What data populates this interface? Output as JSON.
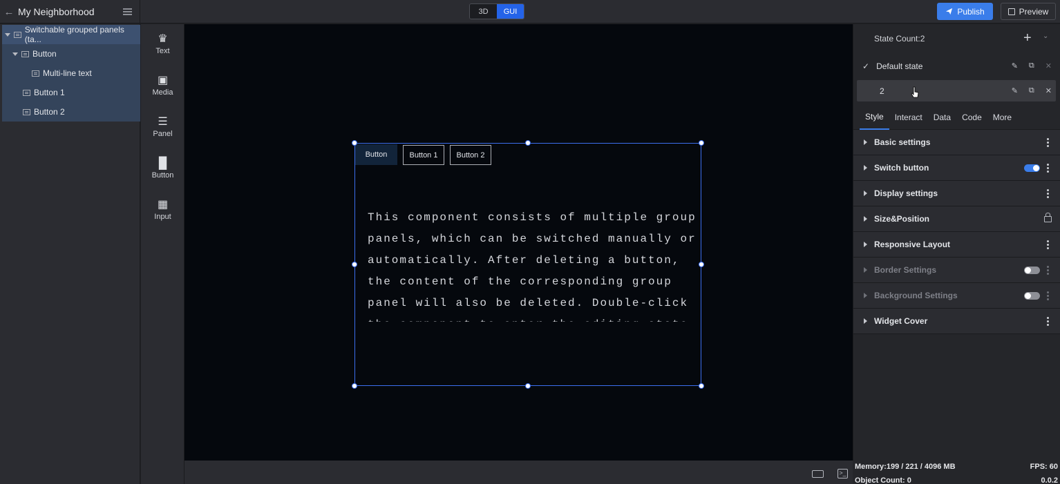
{
  "header": {
    "project_title": "My Neighborhood",
    "mode_3d": "3D",
    "mode_gui": "GUI",
    "publish_label": "Publish",
    "preview_label": "Preview"
  },
  "tree": {
    "items": [
      {
        "label": "Switchable grouped panels (ta..."
      },
      {
        "label": "Button"
      },
      {
        "label": "Multi-line text"
      },
      {
        "label": "Button 1"
      },
      {
        "label": "Button 2"
      }
    ]
  },
  "rail": {
    "items": [
      {
        "label": "Text",
        "icon": "text-icon"
      },
      {
        "label": "Media",
        "icon": "media-icon"
      },
      {
        "label": "Panel",
        "icon": "panel-icon"
      },
      {
        "label": "Button",
        "icon": "button-icon"
      },
      {
        "label": "Input",
        "icon": "input-icon"
      }
    ]
  },
  "canvas": {
    "tabs": [
      "Button",
      "Button 1",
      "Button 2"
    ],
    "panel_text": "This component consists of multiple group panels, which can be switched manually or automatically. After deleting a button, the content of the corresponding group panel will also be deleted. Double-click the component to enter the editing state, and"
  },
  "props": {
    "state_count": "State Count:2",
    "states": [
      {
        "label": "Default state",
        "checked": true
      },
      {
        "label": "2",
        "checked": false
      }
    ],
    "tabs": [
      "Style",
      "Interact",
      "Data",
      "Code",
      "More"
    ],
    "active_tab": "Style",
    "sections": [
      {
        "label": "Basic settings",
        "control": "kebab"
      },
      {
        "label": "Switch button",
        "control": "toggle-on"
      },
      {
        "label": "Display settings",
        "control": "kebab"
      },
      {
        "label": "Size&Position",
        "control": "lock"
      },
      {
        "label": "Responsive Layout",
        "control": "kebab"
      },
      {
        "label": "Border Settings",
        "control": "toggle-off"
      },
      {
        "label": "Background Settings",
        "control": "toggle-off"
      },
      {
        "label": "Widget Cover",
        "control": "kebab"
      }
    ]
  },
  "status": {
    "memory": "Memory:199 / 221 / 4096 MB",
    "fps": "FPS: 60",
    "object_count": "Object Count: 0",
    "version": "0.0.2"
  },
  "colors": {
    "accent": "#3a7dea",
    "selection": "#3c6ff0",
    "canvas_bg": "#05080d"
  }
}
